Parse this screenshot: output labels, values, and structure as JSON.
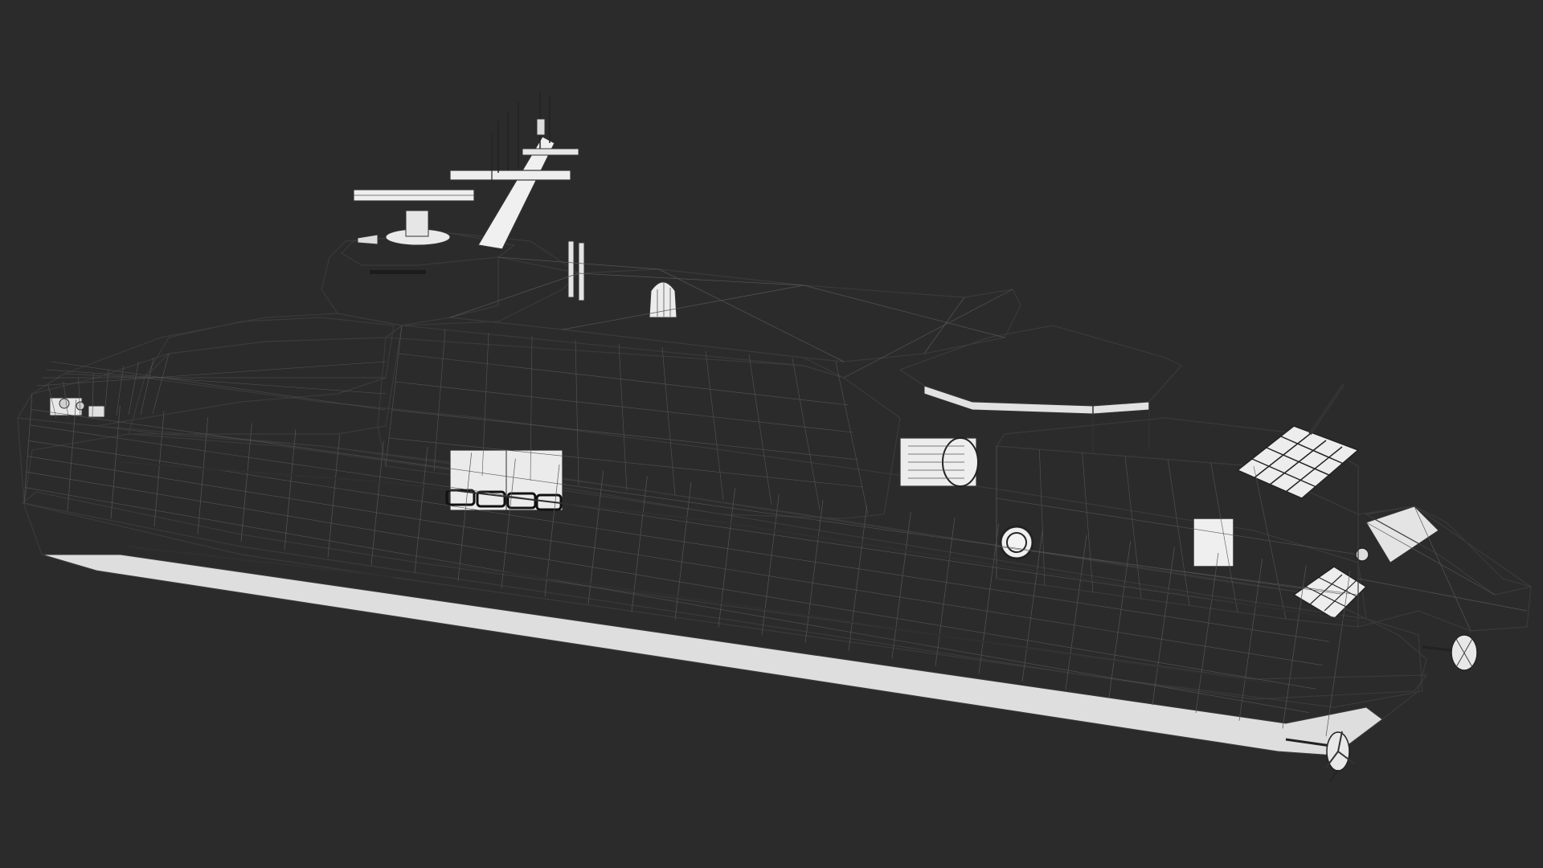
{
  "scene": {
    "background": "#2b2b2b",
    "model_fill": "#f0f0f0",
    "model_shade": "#dcdcdc",
    "wire_color": "#555555"
  }
}
